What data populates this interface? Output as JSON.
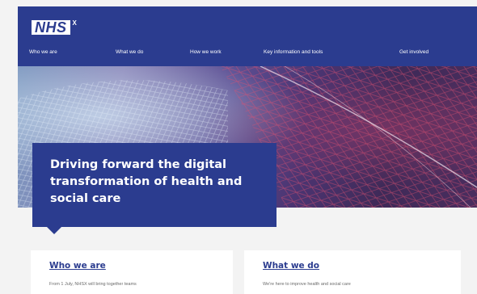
{
  "header": {
    "logo_text": "NHS",
    "logo_suffix": "X",
    "nav_items": [
      {
        "label": "Who we are"
      },
      {
        "label": "What we do"
      },
      {
        "label": "How we work"
      },
      {
        "label": "Key information and tools"
      },
      {
        "label": "Get involved"
      }
    ]
  },
  "hero": {
    "title": "Driving forward the digital transformation of health and social care"
  },
  "cards": [
    {
      "title": "Who we are",
      "text": "From 1 July, NHSX will bring together teams"
    },
    {
      "title": "What we do",
      "text": "We're here to improve health and social care"
    }
  ],
  "colors": {
    "brand": "#2b3c8f",
    "background": "#f3f3f3",
    "card": "#ffffff"
  }
}
